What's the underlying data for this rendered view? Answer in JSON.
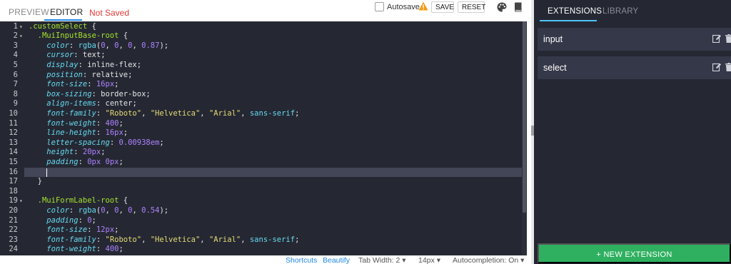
{
  "header": {
    "tabs": [
      {
        "label": "PREVIEW",
        "active": false
      },
      {
        "label": "EDITOR",
        "active": true
      }
    ],
    "status": "Not Saved",
    "autosave_label": "Autosave",
    "autosave_checked": false,
    "save_label": "SAVE",
    "reset_label": "RESET",
    "icons": [
      "warning-icon",
      "palette-icon",
      "book-icon"
    ]
  },
  "editor": {
    "active_line": 16,
    "lines": [
      {
        "n": "1",
        "fold": true,
        "text": ".customSelect {"
      },
      {
        "n": "2",
        "fold": true,
        "text": "  .MuiInputBase-root {"
      },
      {
        "n": "3",
        "fold": false,
        "text": "    color: rgba(0, 0, 0, 0.87);"
      },
      {
        "n": "4",
        "fold": false,
        "text": "    cursor: text;"
      },
      {
        "n": "5",
        "fold": false,
        "text": "    display: inline-flex;"
      },
      {
        "n": "6",
        "fold": false,
        "text": "    position: relative;"
      },
      {
        "n": "7",
        "fold": false,
        "text": "    font-size: 16px;"
      },
      {
        "n": "8",
        "fold": false,
        "text": "    box-sizing: border-box;"
      },
      {
        "n": "9",
        "fold": false,
        "text": "    align-items: center;"
      },
      {
        "n": "10",
        "fold": false,
        "text": "    font-family: \"Roboto\", \"Helvetica\", \"Arial\", sans-serif;"
      },
      {
        "n": "11",
        "fold": false,
        "text": "    font-weight: 400;"
      },
      {
        "n": "12",
        "fold": false,
        "text": "    line-height: 16px;"
      },
      {
        "n": "13",
        "fold": false,
        "text": "    letter-spacing: 0.00938em;"
      },
      {
        "n": "14",
        "fold": false,
        "text": "    height: 20px;"
      },
      {
        "n": "15",
        "fold": false,
        "text": "    padding: 0px 0px;"
      },
      {
        "n": "16",
        "fold": false,
        "text": "    "
      },
      {
        "n": "17",
        "fold": false,
        "text": "  }"
      },
      {
        "n": "18",
        "fold": false,
        "text": ""
      },
      {
        "n": "19",
        "fold": true,
        "text": "  .MuiFormLabel-root {"
      },
      {
        "n": "20",
        "fold": false,
        "text": "    color: rgba(0, 0, 0, 0.54);"
      },
      {
        "n": "21",
        "fold": false,
        "text": "    padding: 0;"
      },
      {
        "n": "22",
        "fold": false,
        "text": "    font-size: 12px;"
      },
      {
        "n": "23",
        "fold": false,
        "text": "    font-family: \"Roboto\", \"Helvetica\", \"Arial\", sans-serif;"
      },
      {
        "n": "24",
        "fold": false,
        "text": "    font-weight: 400;"
      }
    ]
  },
  "statusbar": {
    "shortcuts": "Shortcuts",
    "beautify": "Beautify",
    "tab_width": "Tab Width: 2",
    "font_size": "14px",
    "autocompletion": "Autocompletion: On"
  },
  "sidebar": {
    "tabs": [
      {
        "label": "EXTENSIONS",
        "active": true
      },
      {
        "label": "LIBRARY",
        "active": false
      }
    ],
    "items": [
      {
        "label": "input"
      },
      {
        "label": "select"
      }
    ],
    "new_button": "+ NEW EXTENSION"
  },
  "colors": {
    "editor_bg": "#252833",
    "accent_blue": "#1e88e5",
    "not_saved_red": "#e53935",
    "new_button_green": "#2fb060"
  }
}
